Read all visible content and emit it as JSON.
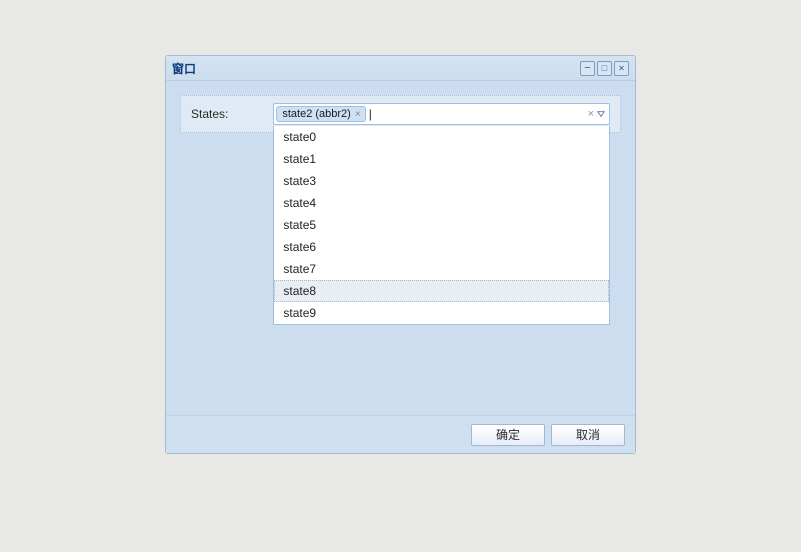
{
  "window": {
    "title": "窗口"
  },
  "form": {
    "states": {
      "label": "States:",
      "selected": [
        {
          "display": "state2 (abbr2)"
        }
      ],
      "input_value": "",
      "options": [
        "state0",
        "state1",
        "state3",
        "state4",
        "state5",
        "state6",
        "state7",
        "state8",
        "state9"
      ],
      "hovered_index": 7
    }
  },
  "buttons": {
    "ok": "确定",
    "cancel": "取消"
  },
  "icons": {
    "tag_close": "×",
    "clear": "×"
  },
  "colors": {
    "window_bg": "#ccddef",
    "border": "#a4b9d4",
    "title": "#0b3d7a"
  }
}
